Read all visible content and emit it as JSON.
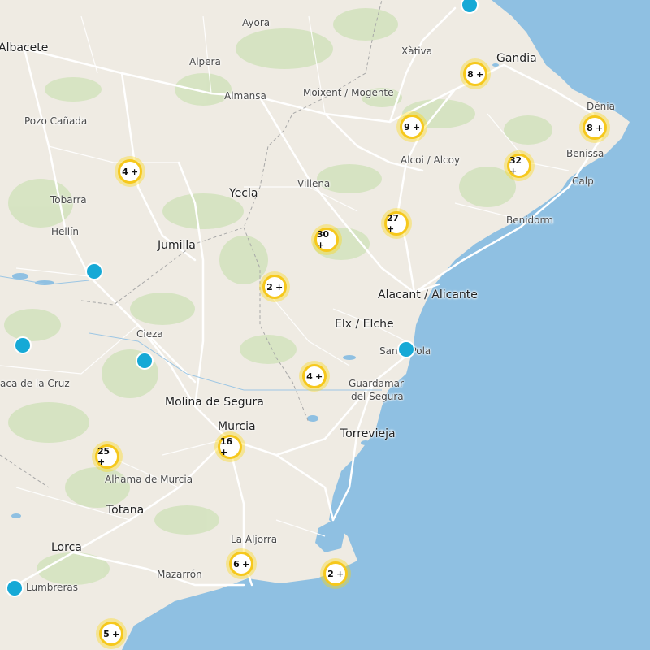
{
  "map": {
    "colors": {
      "land": "#efebe3",
      "sea": "#8fc0e2",
      "road": "#ffffff",
      "forest": "#cfe0b8",
      "cluster_ring": "#f6c81c",
      "marker": "#16a9d6"
    },
    "places": [
      {
        "name": "Ayora"
      },
      {
        "name": "Albacete"
      },
      {
        "name": "Alpera"
      },
      {
        "name": "Xàtiva"
      },
      {
        "name": "Gandia"
      },
      {
        "name": "Almansa"
      },
      {
        "name": "Moixent / Mogente"
      },
      {
        "name": "Dénia"
      },
      {
        "name": "Pozo Cañada"
      },
      {
        "name": "Benissa"
      },
      {
        "name": "Alcoi / Alcoy"
      },
      {
        "name": "Tobarra"
      },
      {
        "name": "Yecla"
      },
      {
        "name": "Villena"
      },
      {
        "name": "Calp"
      },
      {
        "name": "Hellín"
      },
      {
        "name": "Benidorm"
      },
      {
        "name": "Jumilla"
      },
      {
        "name": "Alacant / Alicante"
      },
      {
        "name": "Elx / Elche"
      },
      {
        "name": "Cieza"
      },
      {
        "name": "Santa Pola"
      },
      {
        "name": "Guardamar"
      },
      {
        "name": "del Segura"
      },
      {
        "name": "aca de la Cruz"
      },
      {
        "name": "Molina de Segura"
      },
      {
        "name": "Murcia"
      },
      {
        "name": "Torrevieja"
      },
      {
        "name": "Alhama de Murcia"
      },
      {
        "name": "Totana"
      },
      {
        "name": "La Aljorra"
      },
      {
        "name": "Lorca"
      },
      {
        "name": "Mazarrón"
      },
      {
        "name": "Lumbreras"
      }
    ],
    "clusters": [
      {
        "label": "8 +"
      },
      {
        "label": "9 +"
      },
      {
        "label": "8 +"
      },
      {
        "label": "4 +"
      },
      {
        "label": "32 +"
      },
      {
        "label": "27 +"
      },
      {
        "label": "30 +"
      },
      {
        "label": "2 +"
      },
      {
        "label": "4 +"
      },
      {
        "label": "16 +"
      },
      {
        "label": "25 +"
      },
      {
        "label": "6 +"
      },
      {
        "label": "2 +"
      },
      {
        "label": "5 +"
      }
    ],
    "markers": [
      {
        "id": "marker-1"
      },
      {
        "id": "marker-2"
      },
      {
        "id": "marker-3"
      },
      {
        "id": "marker-4"
      },
      {
        "id": "marker-5"
      },
      {
        "id": "marker-6"
      }
    ]
  }
}
